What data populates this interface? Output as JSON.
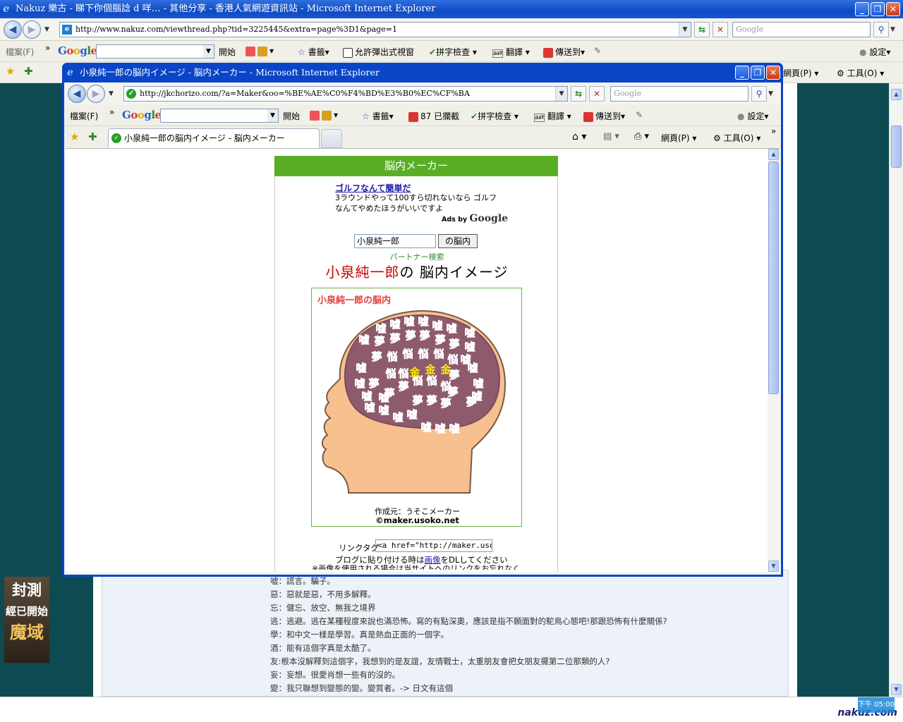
{
  "background_window": {
    "title": "Nakuz 樂古 - 睇下你個腦諗 d 咩… - 其他分享 - 香港人氣網遊資訊站 - Microsoft Internet Explorer",
    "url": "http://www.nakuz.com/viewthread.php?tid=3225445&extra=page%3D1&page=1",
    "search_placeholder": "Google",
    "menu_file": "檔案(F)",
    "google_toolbar": {
      "start": "開始",
      "bookmarks": "書籤▾",
      "popups_allowed": "允許彈出式視窗",
      "spellcheck": "拼字檢查",
      "translate": "翻譯",
      "send_to": "傳送到▾",
      "settings": "設定▾"
    },
    "cmd_bar": {
      "page": "網頁(P)",
      "tools": "工具(O)"
    },
    "post_lines": [
      "嘘：謊言。騙子。",
      "惡：惡就是惡，不用多解釋。",
      "忘：健忘、放空、無我之境界",
      "逃：逃避。逃在某種程度來說也滿恐怖。寫的有點深奧，應該是指不願面對的駝鳥心態吧!那跟恐怖有什麼關係?",
      "學：和中文一樣是學習。真是熱血正面的一個字。",
      "酒：能有這個字真是太酷了。",
      "友:根本沒解釋到這個字，我想到的是友誼，友情戰士，太重朋友會把女朋友擺第二位那類的人?",
      "妄：妄想。很愛肖想一些有的沒的。",
      "變：我只聯想到變態的變。變質者。-> 日文有這個"
    ],
    "ad_banner": {
      "line1": "封測",
      "line2": "經已開始",
      "line3": "魔域"
    },
    "status": {
      "clock": "下午 05:00",
      "logo": "nakuz.com"
    }
  },
  "popup_window": {
    "title": "小泉純一郎の脳内イメージ - 脳内メーカー - Microsoft Internet Explorer",
    "url": "http://jkchorizo.com/?a=Maker&oo=%BE%AE%C0%F4%BD%E3%B0%EC%CF%BA",
    "search_placeholder": "Google",
    "menu_file": "檔案(F)",
    "google_toolbar": {
      "start": "開始",
      "bookmarks": "書籤▾",
      "blocked": "87 已攔截",
      "spellcheck": "拼字檢查",
      "translate": "翻譯",
      "send_to": "傳送到▾",
      "settings": "設定▾"
    },
    "tab_title": "小泉純一郎の脳内イメージ - 脳内メーカー",
    "cmd_bar": {
      "page": "網頁(P)",
      "tools": "工具(O)"
    }
  },
  "page": {
    "header": "脳内メーカー",
    "ad": {
      "link": "ゴルフなんて簡単だ",
      "line1": "3ラウンドやって100すら切れないなら ゴルフ",
      "line2": "なんてやめたほうがいいですよ",
      "ads_by": "Ads by",
      "google": "Google"
    },
    "name_value": "小泉純一郎",
    "submit_label": "の脳内",
    "partner_search": "パートナー検索",
    "headline_name": "小泉純一郎",
    "headline_rest": "の 脳内イメージ",
    "box_title": "小泉純一郎の脳内",
    "credit_line1": "作成元：うそこメーカー",
    "credit_line2": "©maker.usoko.net",
    "linktag_label": "リンクタグ",
    "linktag_value": "<a href=\"http://maker.usoko",
    "blog_note_pre": "ブログに貼り付ける時は",
    "blog_note_link": "画像",
    "blog_note_post": "をDLしてください",
    "cut_note": "※画像を使用される場合は当サイトへのリンクをお忘れなく"
  },
  "chart_data": {
    "type": "table",
    "title": "小泉純一郎の脳内",
    "columns": [
      "kanji"
    ],
    "rows": [
      [
        "嘘"
      ],
      [
        "夢"
      ],
      [
        "悩"
      ],
      [
        "金"
      ]
    ]
  },
  "colors": {
    "accent_green": "#5aae26",
    "lie": "#e01c2c",
    "dream": "#3b3fb0",
    "worry": "#2a4f9a",
    "money": "#ffee00"
  }
}
